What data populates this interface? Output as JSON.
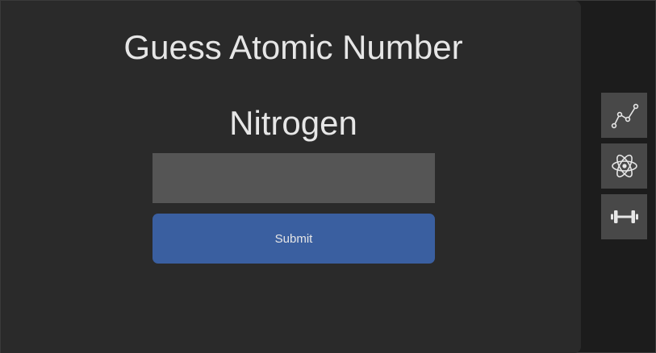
{
  "main": {
    "title": "Guess Atomic Number",
    "element_name": "Nitrogen",
    "answer_input": {
      "value": "",
      "placeholder": ""
    },
    "submit_label": "Submit"
  },
  "side_nav": {
    "items": [
      {
        "icon": "line-chart-icon"
      },
      {
        "icon": "atom-icon"
      },
      {
        "icon": "dumbbell-icon"
      }
    ]
  },
  "colors": {
    "page_background": "#1c1c1c",
    "panel_background": "#2a2a2a",
    "input_background": "#555555",
    "accent": "#3a5fa0",
    "nav_button_background": "#484848",
    "text": "#e6e6e6"
  }
}
